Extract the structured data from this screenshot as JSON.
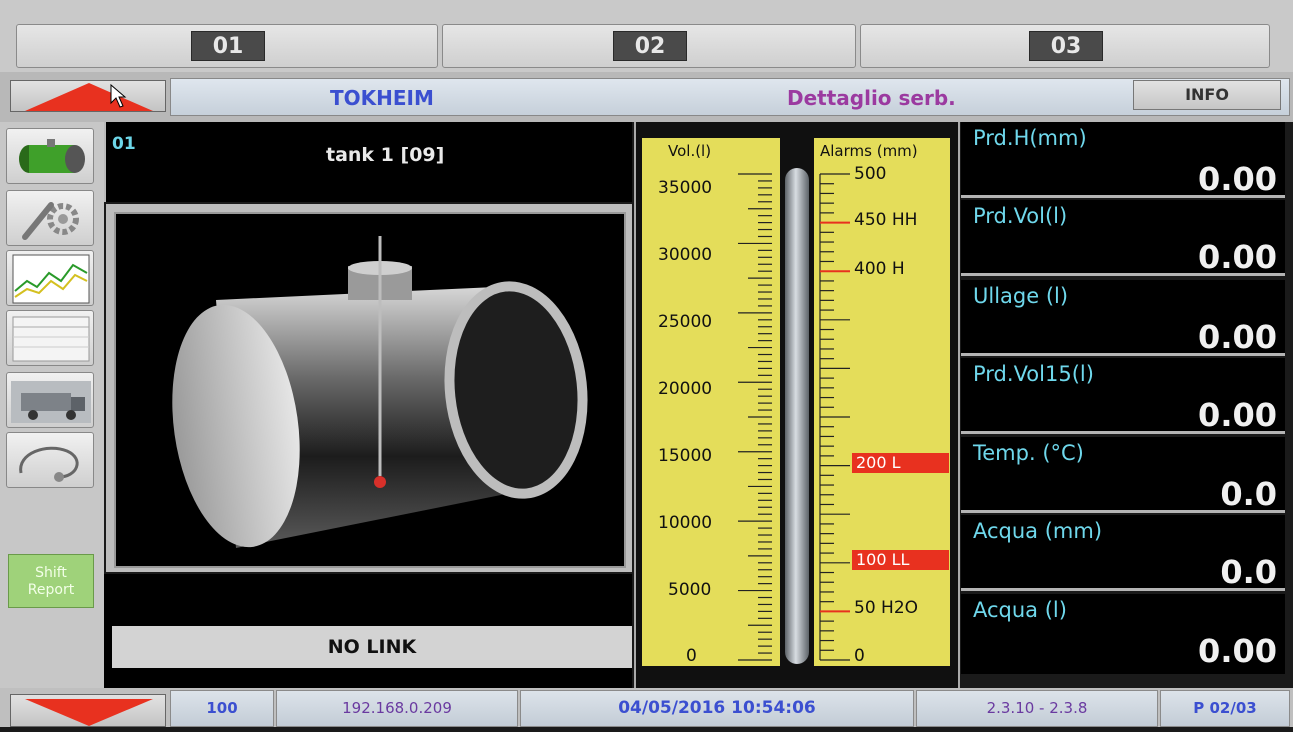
{
  "tabs": [
    {
      "label": "01"
    },
    {
      "label": "02"
    },
    {
      "label": "03"
    }
  ],
  "header": {
    "brand": "TOKHEIM",
    "title": "Dettaglio serb.",
    "info_label": "INFO"
  },
  "sidebar": {
    "items": [
      {
        "icon": "tank-icon"
      },
      {
        "icon": "settings-icon"
      },
      {
        "icon": "trend-chart-icon"
      },
      {
        "icon": "report-table-icon"
      },
      {
        "icon": "truck-icon"
      },
      {
        "icon": "stethoscope-icon"
      }
    ],
    "shift_report_line1": "Shift",
    "shift_report_line2": "Report"
  },
  "tank": {
    "number": "01",
    "name": "tank 1 [09]",
    "status": "NO LINK"
  },
  "gauge": {
    "vol_label": "Vol.(l)",
    "alarms_label": "Alarms (mm)",
    "vol_ticks": [
      "35000",
      "30000",
      "25000",
      "20000",
      "15000",
      "10000",
      "5000",
      "0"
    ],
    "alarm_ticks": [
      {
        "label": "500",
        "highlight": false
      },
      {
        "label": "450 HH",
        "highlight": false
      },
      {
        "label": "400 H",
        "highlight": false
      },
      {
        "label": "200 L",
        "highlight": true
      },
      {
        "label": "100 LL",
        "highlight": true
      },
      {
        "label": "50 H2O",
        "highlight": false
      },
      {
        "label": "0",
        "highlight": false
      }
    ]
  },
  "readings": [
    {
      "label": "Prd.H(mm)",
      "value": "0.00"
    },
    {
      "label": "Prd.Vol(l)",
      "value": "0.00"
    },
    {
      "label": "Ullage (l)",
      "value": "0.00"
    },
    {
      "label": "Prd.Vol15(l)",
      "value": "0.00"
    },
    {
      "label": "Temp. (°C)",
      "value": "0.0"
    },
    {
      "label": "Acqua (mm)",
      "value": "0.0"
    },
    {
      "label": "Acqua (l)",
      "value": "0.00"
    }
  ],
  "statusbar": {
    "level": "100",
    "ip": "192.168.0.209",
    "datetime": "04/05/2016 10:54:06",
    "version": "2.3.10 - 2.3.8",
    "page": "P 02/03"
  },
  "colors": {
    "accent_red": "#e8311f",
    "gauge_yellow": "#e4dd5a",
    "value_label_cyan": "#6fd8ec",
    "brand_blue": "#3b4fd0",
    "title_purple": "#9b3aa0"
  }
}
